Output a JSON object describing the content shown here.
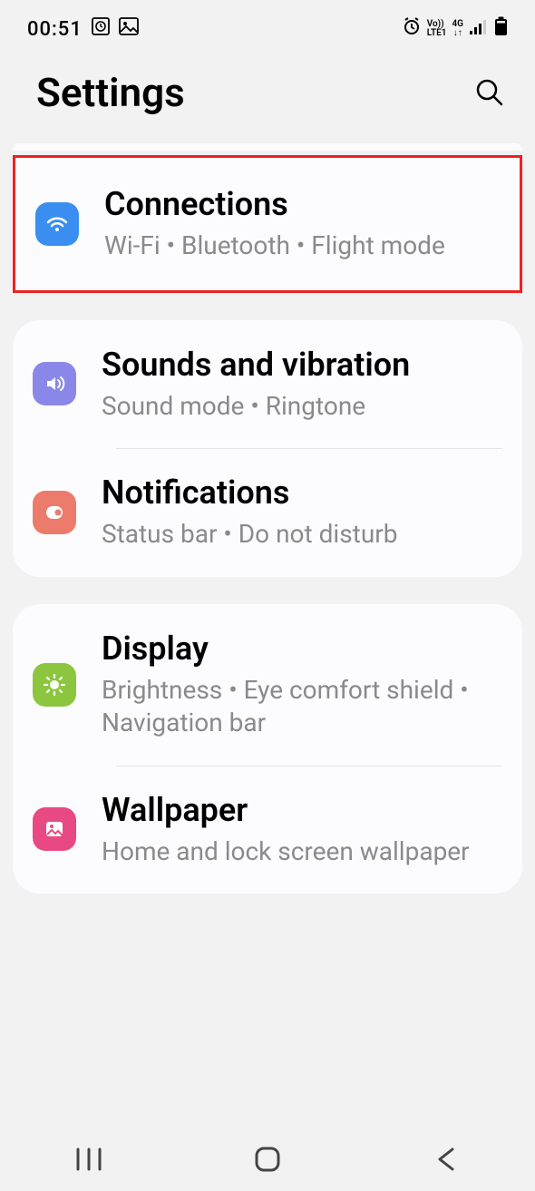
{
  "status": {
    "time": "00:51",
    "volte": "Vo))",
    "lte": "LTE1",
    "net": "4G"
  },
  "header": {
    "title": "Settings"
  },
  "groups": [
    {
      "items": [
        {
          "title": "Connections",
          "subtitle": "Wi-Fi  •  Bluetooth  •  Flight mode"
        }
      ]
    },
    {
      "items": [
        {
          "title": "Sounds and vibration",
          "subtitle": "Sound mode  •  Ringtone"
        },
        {
          "title": "Notifications",
          "subtitle": "Status bar  •  Do not disturb"
        }
      ]
    },
    {
      "items": [
        {
          "title": "Display",
          "subtitle": "Brightness  •  Eye comfort shield  •  Navigation bar"
        },
        {
          "title": "Wallpaper",
          "subtitle": "Home and lock screen wallpaper"
        }
      ]
    }
  ]
}
